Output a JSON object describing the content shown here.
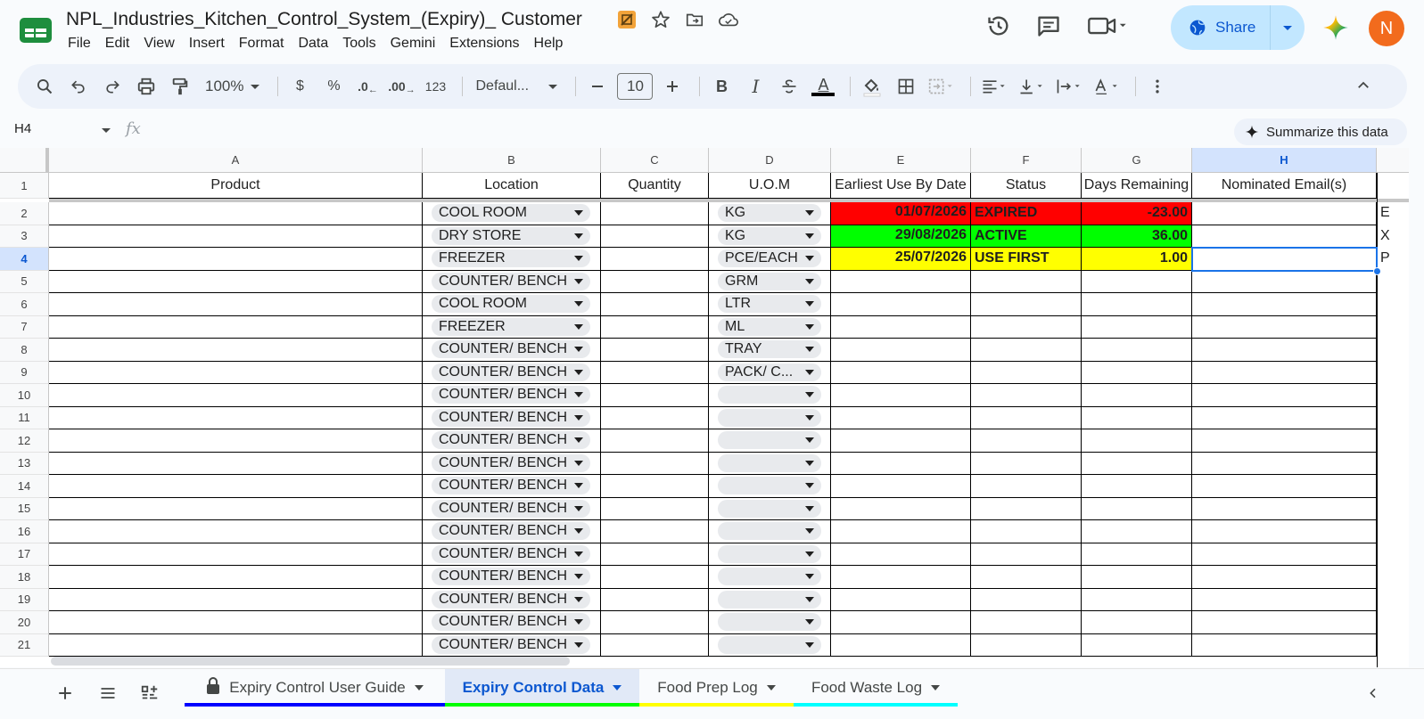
{
  "document": {
    "title": "NPL_Industries_Kitchen_Control_System_(Expiry)_ Customer"
  },
  "menu": [
    "File",
    "Edit",
    "View",
    "Insert",
    "Format",
    "Data",
    "Tools",
    "Gemini",
    "Extensions",
    "Help"
  ],
  "share": {
    "label": "Share"
  },
  "avatar": {
    "initial": "N",
    "color": "#f26b1d"
  },
  "toolbar": {
    "zoom": "100%",
    "currency": "$",
    "percent": "%",
    "dec_decrease": ".0",
    "dec_increase": ".00",
    "number_format": "123",
    "font": "Defaul...",
    "font_size": "10",
    "bold": "B",
    "italic": "I",
    "text_color": "A"
  },
  "formula_bar": {
    "cell_ref": "H4",
    "fx": "fx",
    "value": ""
  },
  "summarize": {
    "label": "Summarize this data"
  },
  "columns": [
    "A",
    "B",
    "C",
    "D",
    "E",
    "F",
    "G",
    "H"
  ],
  "headers": [
    "Product",
    "Location",
    "Quantity",
    "U.O.M",
    "Earliest Use By Date",
    "Status",
    "Days Remaining",
    "Nominated Email(s)"
  ],
  "row_numbers": [
    "1",
    "2",
    "3",
    "4",
    "5",
    "6",
    "7",
    "8",
    "9",
    "10",
    "11",
    "12",
    "13",
    "14",
    "15",
    "16",
    "17",
    "18",
    "19",
    "20",
    "21"
  ],
  "rows": [
    {
      "location": "COOL ROOM",
      "uom": "KG",
      "date": "01/07/2026",
      "status": "EXPIRED",
      "days": "-23.00",
      "color": "#ff0000",
      "overflow": "E"
    },
    {
      "location": "DRY STORE",
      "uom": "KG",
      "date": "29/08/2026",
      "status": "ACTIVE",
      "days": "36.00",
      "color": "#00ff00",
      "overflow": "X"
    },
    {
      "location": "FREEZER",
      "uom": "PCE/EACH",
      "date": "25/07/2026",
      "status": "USE FIRST",
      "days": "1.00",
      "color": "#ffff00",
      "overflow": "P"
    },
    {
      "location": "COUNTER/ BENCH",
      "uom": "GRM"
    },
    {
      "location": "COOL ROOM",
      "uom": "LTR"
    },
    {
      "location": "FREEZER",
      "uom": "ML"
    },
    {
      "location": "COUNTER/ BENCH",
      "uom": "TRAY"
    },
    {
      "location": "COUNTER/ BENCH",
      "uom": "PACK/ C..."
    },
    {
      "location": "COUNTER/ BENCH",
      "uom": ""
    },
    {
      "location": "COUNTER/ BENCH",
      "uom": ""
    },
    {
      "location": "COUNTER/ BENCH",
      "uom": ""
    },
    {
      "location": "COUNTER/ BENCH",
      "uom": ""
    },
    {
      "location": "COUNTER/ BENCH",
      "uom": ""
    },
    {
      "location": "COUNTER/ BENCH",
      "uom": ""
    },
    {
      "location": "COUNTER/ BENCH",
      "uom": ""
    },
    {
      "location": "COUNTER/ BENCH",
      "uom": ""
    },
    {
      "location": "COUNTER/ BENCH",
      "uom": ""
    },
    {
      "location": "COUNTER/ BENCH",
      "uom": ""
    },
    {
      "location": "COUNTER/ BENCH",
      "uom": ""
    },
    {
      "location": "COUNTER/ BENCH",
      "uom": ""
    }
  ],
  "sheets": [
    {
      "name": "Expiry Control User Guide",
      "color": "#0000ff",
      "locked": true
    },
    {
      "name": "Expiry Control Data",
      "color": "#00ff00",
      "active": true
    },
    {
      "name": "Food Prep Log",
      "color": "#ffff00"
    },
    {
      "name": "Food Waste Log",
      "color": "#00ffff"
    }
  ],
  "colors": {
    "accent": "#0b57d0",
    "selection": "#1a73e8"
  }
}
